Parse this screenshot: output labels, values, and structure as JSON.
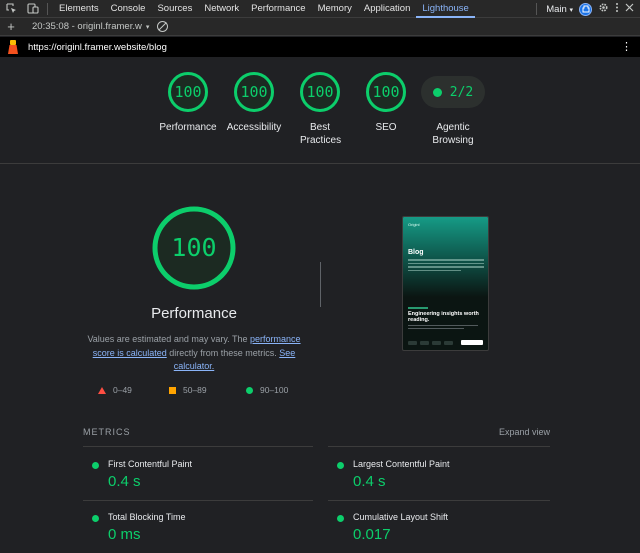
{
  "devtools": {
    "tabs": [
      "Elements",
      "Console",
      "Sources",
      "Network",
      "Performance",
      "Memory",
      "Application",
      "Lighthouse"
    ],
    "active_tab": "Lighthouse",
    "context_label": "Main",
    "context_caret": "▾",
    "tab_icons": [
      "inspect-element-icon",
      "device-toolbar-icon"
    ],
    "right_icons": [
      "extension-icon",
      "gear-icon",
      "kebab-menu-icon",
      "close-icon"
    ]
  },
  "toolbar": {
    "new_report": "+",
    "report_selector": "20:35:08 - originl.framer.w",
    "caret": "▾"
  },
  "url_bar": {
    "url": "https://originl.framer.website/blog",
    "menu_glyph": "⋮"
  },
  "summary": {
    "gauges": [
      {
        "score": "100",
        "label": "Performance",
        "value": 1.0
      },
      {
        "score": "100",
        "label": "Accessibility",
        "value": 1.0
      },
      {
        "score": "100",
        "label": "Best Practices",
        "value": 1.0
      },
      {
        "score": "100",
        "label": "SEO",
        "value": 1.0
      }
    ],
    "agentic": {
      "score": "2/2",
      "label": "Agentic Browsing"
    }
  },
  "performance": {
    "score": "100",
    "score_value": 1.0,
    "title": "Performance",
    "desc_prefix": "Values are estimated and may vary. The ",
    "desc_link1": "performance score is calculated",
    "desc_middle": " directly from these metrics. ",
    "desc_link2": "See calculator.",
    "legend": [
      {
        "shape": "triangle",
        "range": "0–49",
        "color": "#ff4e42"
      },
      {
        "shape": "square",
        "range": "50–89",
        "color": "#ffa400"
      },
      {
        "shape": "circle",
        "range": "90–100",
        "color": "#0cce6b"
      }
    ]
  },
  "thumbnail": {
    "logo_text": "Originl",
    "page_title": "Blog",
    "headline": "Engineering insights worth reading."
  },
  "metrics": {
    "title": "METRICS",
    "expand_label": "Expand view",
    "items": [
      {
        "name": "First Contentful Paint",
        "value": "0.4 s"
      },
      {
        "name": "Largest Contentful Paint",
        "value": "0.4 s"
      },
      {
        "name": "Total Blocking Time",
        "value": "0 ms"
      },
      {
        "name": "Cumulative Layout Shift",
        "value": "0.017"
      }
    ]
  },
  "colors": {
    "pass": "#0cce6b",
    "average": "#ffa400",
    "fail": "#ff4e42",
    "link": "#8ab4f8",
    "background": "#202124"
  }
}
